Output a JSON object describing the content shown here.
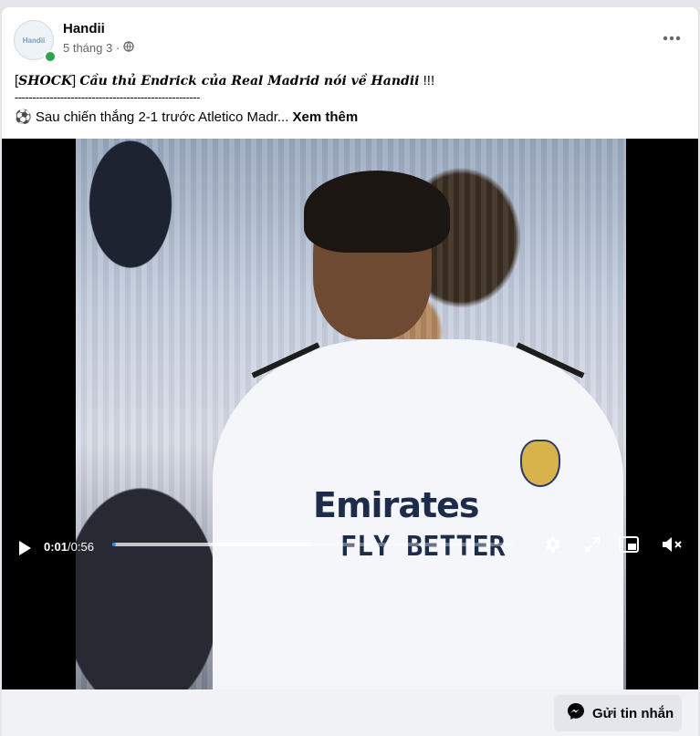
{
  "post": {
    "page_name": "Handii",
    "avatar_text": "Handii",
    "time_ago": "5 tháng 3 ·",
    "privacy_icon": "globe-icon",
    "more_icon": "more-options-icon",
    "text_line1_open": "[",
    "text_line1_styled_1": "SHOCK",
    "text_line1_close": "] ",
    "text_line1_styled_2": "Cầu thủ Endrick của Real Madrid nói về Handii",
    "text_line1_suffix": " !!!",
    "separator": "-----------------------------------------------------",
    "line3_emoji": "⚽",
    "line3_text": " Sau chiến thắng 2-1 trước Atletico Madr... ",
    "see_more": "Xem thêm"
  },
  "video": {
    "jersey_sponsor_1": "Emirates",
    "jersey_sponsor_2": "FLY BETTER",
    "current_time": "0:01",
    "separator": " / ",
    "duration": "0:56",
    "progress_played": 0.005,
    "progress_buffered": 0.5,
    "icons": [
      "play-icon",
      "settings-gear-icon",
      "fullscreen-icon",
      "picture-in-picture-icon",
      "muted-volume-icon"
    ]
  },
  "footer": {
    "message_button": "Gửi tin nhắn",
    "message_icon": "messenger-icon"
  }
}
